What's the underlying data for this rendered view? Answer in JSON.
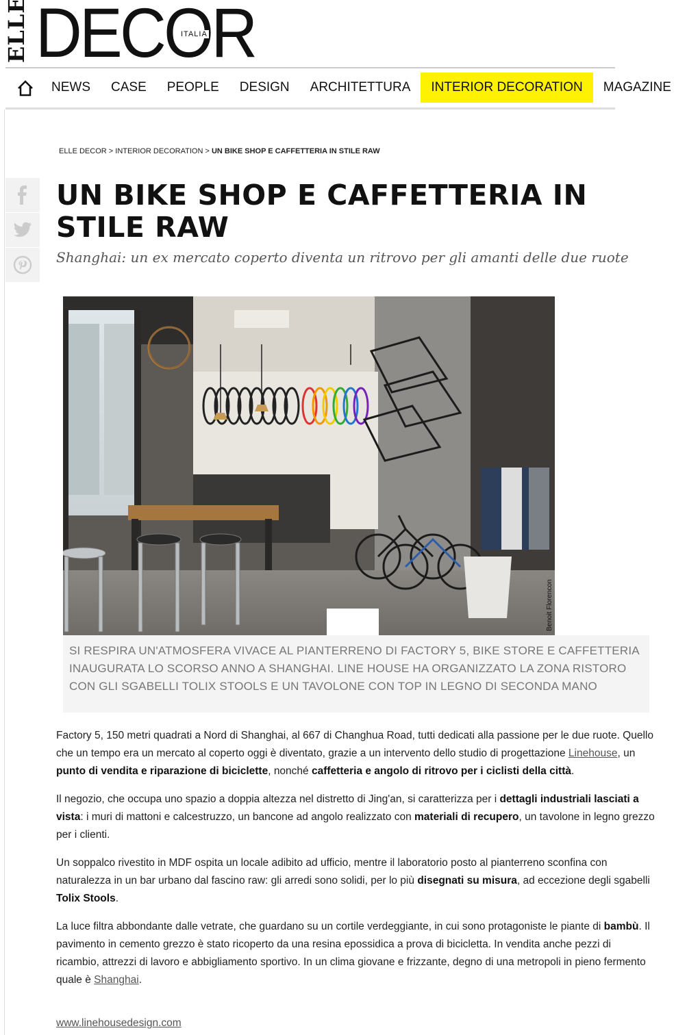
{
  "logo": {
    "elle": "ELLE",
    "decor": "DECOR",
    "italia": "ITALIA"
  },
  "nav": {
    "home_icon": "home-icon",
    "items": [
      "NEWS",
      "CASE",
      "PEOPLE",
      "DESIGN",
      "ARCHITETTURA",
      "INTERIOR DECORATION",
      "MAGAZINE"
    ],
    "active": "INTERIOR DECORATION",
    "active_color": "#fff200"
  },
  "breadcrumb": {
    "home": "ELLE DECOR",
    "sep": ">",
    "section": "INTERIOR DECORATION",
    "current": "UN BIKE SHOP E CAFFETTERIA IN STILE RAW"
  },
  "share": {
    "icons": [
      "facebook-icon",
      "twitter-icon",
      "pinterest-icon"
    ]
  },
  "article": {
    "title": "UN BIKE SHOP E CAFFETTERIA IN STILE RAW",
    "subtitle": "Shanghai: un ex mercato coperto diventa un ritrovo per gli amanti delle due ruote",
    "photo_credit": "Benoit Florencon",
    "caption": "Si respira un'atmosfera vivace al pianterreno di Factory 5, bike store e caffetteria inaugurata lo scorso anno a Shanghai. Line House ha organizzato la zona ristoro con gli sgabelli Tolix Stools e un tavolone con top in legno di seconda mano",
    "p1": {
      "t1": "Factory 5, 150 metri quadrati a Nord di Shanghai, al 667 di Changhua Road, tutti dedicati alla passione per le due ruote. Quello che un tempo era un mercato al coperto oggi è diventato, grazie a un intervento dello studio di progettazione ",
      "link": "Linehouse",
      "t2": ", un ",
      "b1": "punto di vendita e riparazione di biciclette",
      "t3": ", nonché ",
      "b2": "caffetteria e angolo di ritrovo per i ciclisti della città",
      "t4": "."
    },
    "p2": {
      "t1": "Il negozio, che occupa uno spazio a doppia altezza nel distretto di Jing'an, si caratterizza per i ",
      "b1": "dettagli industriali lasciati a vista",
      "t2": ": i muri di mattoni e calcestruzzo, un bancone ad angolo realizzato con ",
      "b2": "materiali di recupero",
      "t3": ", un tavolone in legno grezzo per i clienti."
    },
    "p3": {
      "t1": "Un soppalco rivestito in MDF ospita un locale adibito ad ufficio, mentre il laboratorio posto al pianterreno sconfina con naturalezza in un bar urbano dal fascino raw: gli arredi sono solidi, per lo più ",
      "b1": "disegnati su misura",
      "t2": ", ad eccezione degli sgabelli ",
      "b2": "Tolix Stools",
      "t3": "."
    },
    "p4": {
      "t1": "La luce filtra abbondante dalle vetrate, che guardano su un cortile verdeggiante, in cui sono protagoniste le piante di ",
      "b1": "bambù",
      "t2": ". Il pavimento in cemento grezzo è stato ricoperto da una resina epossidica a prova di bicicletta. In vendita anche pezzi di ricambio, attrezzi di lavoro e abbigliamento sportivo. In un clima giovane e frizzante, degno di una metropoli in pieno fermento quale è ",
      "link": "Shanghai",
      "t3": "."
    },
    "site_link": "www.linehousedesign.com"
  }
}
